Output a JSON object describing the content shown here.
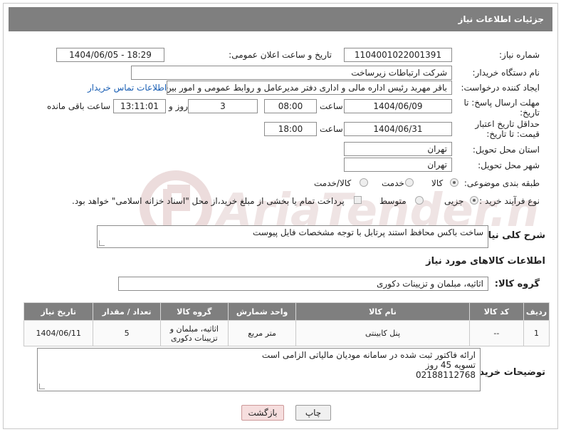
{
  "header": {
    "title": "جزئیات اطلاعات نیاز"
  },
  "form": {
    "need_number_label": "شماره نیاز:",
    "need_number": "1104001022001391",
    "announce_label": "تاریخ و ساعت اعلان عمومی:",
    "announce_value": "1404/06/05 - 18:29",
    "buyer_org_label": "نام دستگاه خریدار:",
    "buyer_org": "شرکت ارتباطات زیرساخت",
    "requester_label": "ایجاد کننده درخواست:",
    "requester": "باقر مهربد رئیس اداره مالی و اداری دفتر مدیرعامل و روابط عمومی و امور بین الم",
    "contact_link": "اطلاعات تماس خریدار",
    "deadline_label": "مهلت ارسال پاسخ: تا تاریخ:",
    "deadline_date": "1404/06/09",
    "time_label": "ساعت",
    "deadline_time": "08:00",
    "days_value": "3",
    "days_label": "روز و",
    "remaining_time": "13:11:01",
    "remaining_label": "ساعت باقی مانده",
    "price_validity_label": "حداقل تاریخ اعتبار قیمت: تا تاریخ:",
    "price_validity_date": "1404/06/31",
    "price_validity_time": "18:00",
    "province_label": "استان محل تحویل:",
    "province": "تهران",
    "city_label": "شهر محل تحویل:",
    "city": "تهران",
    "category_label": "طبقه بندی موضوعی:",
    "category_options": [
      "کالا",
      "خدمت",
      "کالا/خدمت"
    ],
    "process_label": "نوع فرآیند خرید :",
    "process_options": [
      "جزیی",
      "متوسط"
    ],
    "payment_note": "پرداخت تمام یا بخشی از مبلغ خرید،از محل \"اسناد خزانه اسلامی\" خواهد بود.",
    "description_label": "شرح کلی نیاز:",
    "description": "ساخت باکس محافظ استند پرتابل با توجه مشخصات فایل پیوست"
  },
  "goods": {
    "section_title": "اطلاعات کالاهای مورد نیاز",
    "group_label": "گروه کالا:",
    "group_value": "اثاثیه، مبلمان و تزیینات دکوری",
    "columns": [
      "ردیف",
      "کد کالا",
      "نام کالا",
      "واحد شمارش",
      "گروه کالا",
      "تعداد / مقدار",
      "تاریخ نیاز"
    ],
    "rows": [
      {
        "row": "1",
        "code": "--",
        "name": "پنل کابینتی",
        "unit": "متر مربع",
        "group": "اثاثیه، مبلمان و تزیینات دکوری",
        "qty": "5",
        "date": "1404/06/11"
      }
    ]
  },
  "buyer_notes": {
    "label": "توضیحات خریدار:",
    "line1": "ارائه فاکتور ثبت شده در سامانه مودیان مالیاتی الزامی است",
    "line2": "تسویه 45 روز",
    "line3": "02188112768"
  },
  "buttons": {
    "print": "چاپ",
    "back": "بازگشت"
  },
  "colors": {
    "header_bg": "#7f7f7f",
    "link": "#1a5fb4",
    "watermark": "#e8d6d6"
  }
}
